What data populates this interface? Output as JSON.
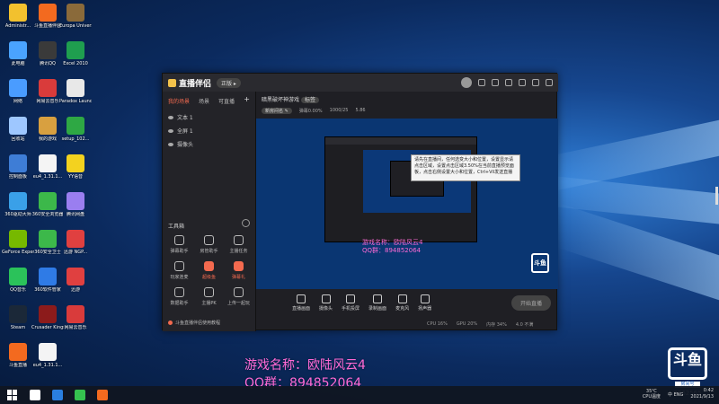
{
  "desktop": {
    "icons": [
      {
        "label": "Administr...",
        "color": "#f2c12e"
      },
      {
        "label": "斗鱼直播伴侣",
        "color": "#f36a1f"
      },
      {
        "label": "Europa Universal...",
        "color": "#8a6a3a"
      },
      {
        "label": "此电脑",
        "color": "#4aa3ff"
      },
      {
        "label": "腾讯QQ",
        "color": "#3a3a3a"
      },
      {
        "label": "Excel 2010",
        "color": "#1f9e4f"
      },
      {
        "label": "网络",
        "color": "#4a9cff"
      },
      {
        "label": "网易云音乐",
        "color": "#d93b3b"
      },
      {
        "label": "Paradox Launcher v2",
        "color": "#e8e8e8"
      },
      {
        "label": "回收站",
        "color": "#9ec7ff"
      },
      {
        "label": "我的游戏",
        "color": "#d8a040"
      },
      {
        "label": "setup_102...",
        "color": "#2ea844"
      },
      {
        "label": "控制面板",
        "color": "#3e7dd6"
      },
      {
        "label": "eu4_1.31.1...",
        "color": "#f4f4f4"
      },
      {
        "label": "YY语音",
        "color": "#f3d21f"
      },
      {
        "label": "360驱动大师",
        "color": "#3aa0e8"
      },
      {
        "label": "360安全浏览器",
        "color": "#3cb84a"
      },
      {
        "label": "腾讯网盘",
        "color": "#9a7ef0"
      },
      {
        "label": "GeForce Experience",
        "color": "#76b900"
      },
      {
        "label": "360安全卫士",
        "color": "#3cb84a"
      },
      {
        "label": "迅游 NGP...",
        "color": "#e04040"
      },
      {
        "label": "QQ音乐",
        "color": "#2bc25a"
      },
      {
        "label": "360软件管家",
        "color": "#2f7be6"
      },
      {
        "label": "迅游",
        "color": "#e04040"
      },
      {
        "label": "Steam",
        "color": "#1b2838"
      },
      {
        "label": "Crusader Kings III",
        "color": "#8c1b1b"
      },
      {
        "label": "网易云音乐",
        "color": "#d93b3b"
      },
      {
        "label": "斗鱼直播",
        "color": "#f36a1f"
      },
      {
        "label": "eu4_1.31.1...",
        "color": "#f4f4f4"
      }
    ]
  },
  "app": {
    "title": "直播伴侣",
    "version_label": "正版 ▸",
    "sidebar_tabs": [
      "我的场景",
      "场景",
      "可直播"
    ],
    "sources": [
      "文本 1",
      "全屏 1",
      "摄像头"
    ],
    "tools_title": "工具箱",
    "tools": [
      {
        "label": "弹幕助手",
        "hot": false
      },
      {
        "label": "房管助手",
        "hot": false
      },
      {
        "label": "主播任务",
        "hot": false
      },
      {
        "label": "玩家连麦",
        "hot": false
      },
      {
        "label": "超级鱼",
        "hot": true
      },
      {
        "label": "弹幕礼",
        "hot": true
      },
      {
        "label": "数据助手",
        "hot": false
      },
      {
        "label": "主播PK",
        "hot": false
      },
      {
        "label": "上传一起玩",
        "hot": false
      }
    ],
    "sidebar_footer": "斗鱼直播伴侣使用教程",
    "stream_title": "暗黑破坏神游戏",
    "stream_tag": "标签",
    "stream_meta": [
      "新房间名 ✎",
      "弹幕0.00%",
      "1000/25",
      "5.86"
    ],
    "tooltip_text": "请先在直播间，任何选变大小和位置，设置显示请点击区域，设置点击区域3.50%在当前直播预览面板，点击右侧设置大小和位置，Ctrl+Vil发送直播",
    "overlay_game": "游戏名称：欧陆风云4",
    "overlay_qq": "QQ群：894852064",
    "sponsor_mark": "斗鱼",
    "controls": [
      "直播画面",
      "摄像头",
      "手机投屏",
      "录制画面",
      "麦克风",
      "扬声器"
    ],
    "go_live_label": "开始直播",
    "status": [
      "CPU 16%",
      "GPU 20%",
      "内存 34%",
      "4.0 不满"
    ]
  },
  "overlay": {
    "game": "游戏名称：欧陆风云4",
    "qq": "QQ群：894852064"
  },
  "douyu": {
    "logo_text": "斗鱼",
    "room_label": "房间号",
    "room_number": "9262565"
  },
  "taskbar": {
    "items": [
      {
        "color": "#ffffff"
      },
      {
        "color": "#2a7fe0"
      },
      {
        "color": "#35c24f"
      },
      {
        "color": "#f36a1f"
      }
    ],
    "temp": "35℃",
    "temp_label": "CPU温度",
    "time": "0:42",
    "date": "2021/9/13",
    "notif": "中 ENG"
  }
}
